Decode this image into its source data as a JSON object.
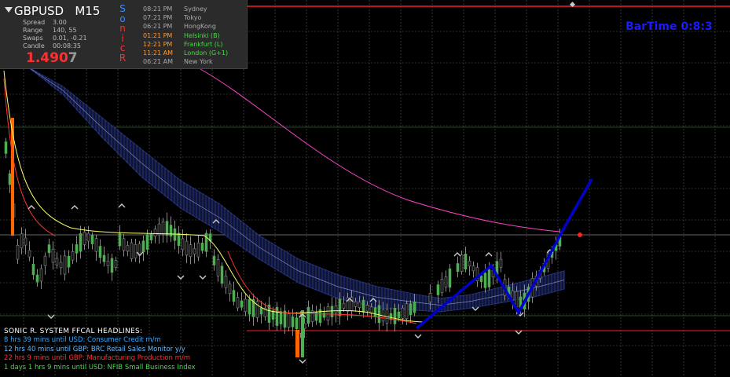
{
  "header": {
    "symbol": "GBPUSD",
    "timeframe": "M15",
    "spread_label": "Spread",
    "spread_value": "3.00",
    "range_label": "Range",
    "range_value": "140, 55",
    "swaps_label": "Swaps",
    "swaps_value": "0.01, -0.21",
    "candle_label": "Candle",
    "candle_value": "00:08:35",
    "price_main": "1.490",
    "price_tail": "7"
  },
  "sonic_letters": [
    {
      "ch": "S",
      "color": "#3a8cff"
    },
    {
      "ch": "o",
      "color": "#3a8cff"
    },
    {
      "ch": "n",
      "color": "#ff3030"
    },
    {
      "ch": "i",
      "color": "#ff3030"
    },
    {
      "ch": "c",
      "color": "#ff3030"
    },
    {
      "ch": "R",
      "color": "#ff3030"
    }
  ],
  "sessions": [
    {
      "time": "08:21 PM",
      "city": "Sydney",
      "color": "#aaaaaa"
    },
    {
      "time": "07:21 PM",
      "city": "Tokyo",
      "color": "#aaaaaa"
    },
    {
      "time": "06:21 PM",
      "city": "HongKong",
      "color": "#aaaaaa"
    },
    {
      "time": "01:21 PM",
      "city": "Helsinki  (B)",
      "color": "#ff9933",
      "city_color": "#44dd44"
    },
    {
      "time": "12:21 PM",
      "city": "Frankfurt  (L)",
      "color": "#ff9933",
      "city_color": "#44dd44"
    },
    {
      "time": "11:21 AM",
      "city": "London  (G+1)",
      "color": "#ff9933",
      "city_color": "#44dd44"
    },
    {
      "time": "06:21 AM",
      "city": "New York",
      "color": "#aaaaaa"
    }
  ],
  "bartime": "BarTime    0:8:3",
  "news": {
    "heading": "SONIC R. SYSTEM  FFCAL HEADLINES:",
    "items": [
      {
        "text": "8 hrs 39 mins until USD: Consumer Credit m/m",
        "color": "#33aaff"
      },
      {
        "text": "12 hrs 40 mins until GBP: BRC Retail Sales Monitor y/y",
        "color": "#66bbff"
      },
      {
        "text": "22 hrs 9 mins until GBP: Manufacturing Production m/m",
        "color": "#ff3030"
      },
      {
        "text": "1 days 1 hrs 9 mins until USD: NFIB Small Business Index",
        "color": "#44dd44"
      }
    ]
  },
  "colors": {
    "bull": "#4caf50",
    "bear": "#000000",
    "grid": "#555555",
    "wave": "#2a3a7a",
    "ema_pink": "#ff44cc",
    "ema_yellow": "#ffff66",
    "zigzag": "#0000cc",
    "hline_red": "#ff2020",
    "hline_white": "#888888"
  }
}
